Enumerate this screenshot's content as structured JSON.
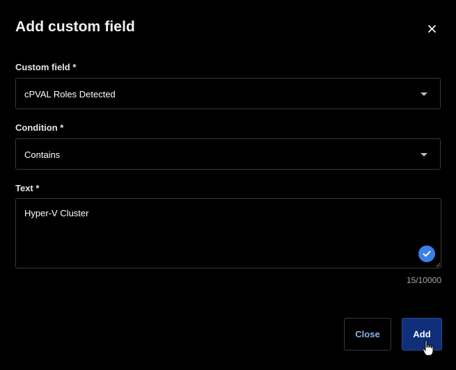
{
  "dialog": {
    "title": "Add custom field"
  },
  "fields": {
    "custom_field": {
      "label": "Custom field *",
      "value": "cPVAL Roles Detected"
    },
    "condition": {
      "label": "Condition *",
      "value": "Contains"
    },
    "text": {
      "label": "Text *",
      "value": "Hyper-V Cluster",
      "counter": "15/10000"
    }
  },
  "buttons": {
    "close_label": "Close",
    "add_label": "Add"
  },
  "icons": {
    "close": "close-icon",
    "dropdown": "chevron-down-icon",
    "valid": "check-circle-icon",
    "cursor": "hand-pointer-icon"
  },
  "colors": {
    "background": "#000000",
    "primary_button": "#0f2f7a",
    "link_text": "#8ab2f0",
    "check_badge": "#3d7fea"
  }
}
